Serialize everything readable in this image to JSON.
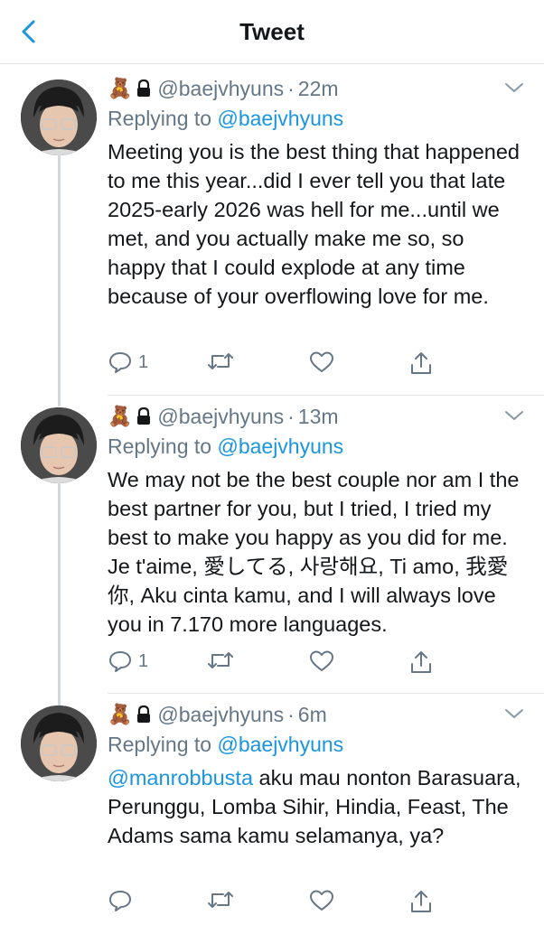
{
  "header": {
    "title": "Tweet"
  },
  "tweets": [
    {
      "emoji": "🧸",
      "handle": "@baejvhyuns",
      "separator": "·",
      "time": "22m",
      "replying_prefix": "Replying to ",
      "replying_to": "@baejvhyuns",
      "text": "Meeting you is the best thing that happened to me this year...did I ever tell you that late 2025-early 2026 was hell for me...until we met, and you actually make me so, so happy that I could explode at any time because of your overflowing love for me.",
      "reply_count": "1"
    },
    {
      "emoji": "🧸",
      "handle": "@baejvhyuns",
      "separator": "·",
      "time": "13m",
      "replying_prefix": "Replying to ",
      "replying_to": "@baejvhyuns",
      "text": "We may not be the best couple nor am I the best partner for you, but I tried, I tried my best to make you happy as you did for me. Je t'aime, 愛してる, 사랑해요, Ti amo, 我愛你, Aku cinta kamu, and I will always love you in 7.170 more languages.",
      "reply_count": "1"
    },
    {
      "emoji": "🧸",
      "handle": "@baejvhyuns",
      "separator": "·",
      "time": "6m",
      "replying_prefix": "Replying to ",
      "replying_to": "@baejvhyuns",
      "mention": "@manrobbusta",
      "text": " aku mau nonton Barasuara, Perunggu, Lomba Sihir, Hindia, Feast, The Adams sama kamu selamanya, ya?",
      "reply_count": ""
    }
  ],
  "colors": {
    "accent": "#1b95e0",
    "muted": "#657786",
    "text": "#14171a",
    "border": "#e1e4e8"
  },
  "icons": [
    "back-chevron-icon",
    "lock-icon",
    "chevron-down-icon",
    "reply-icon",
    "retweet-icon",
    "like-icon",
    "share-icon"
  ]
}
